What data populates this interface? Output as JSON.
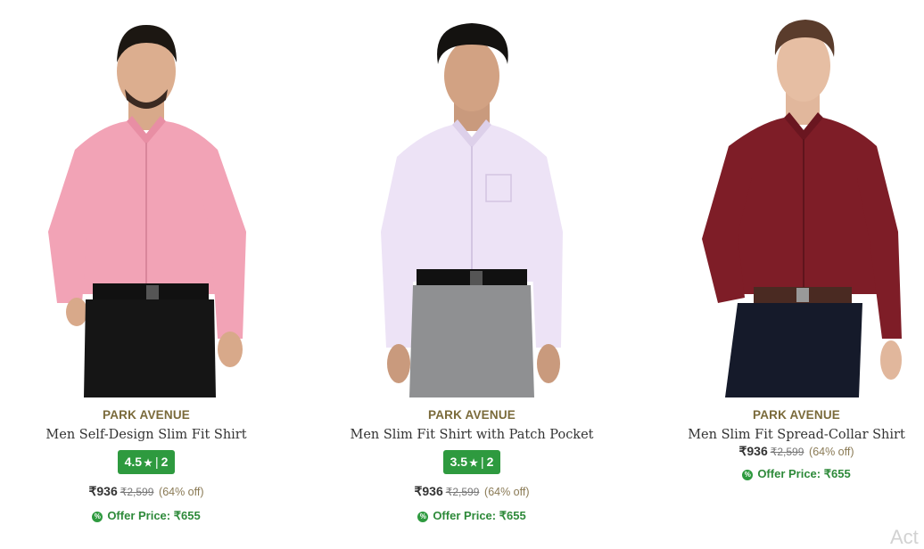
{
  "brand_color": "#7a6a3a",
  "rating_color": "#2e9a3f",
  "products": [
    {
      "brand": "PARK AVENUE",
      "title": "Men Self-Design Slim Fit Shirt",
      "rating": "4.5",
      "review_count": "2",
      "price": "₹936",
      "mrp": "₹2,599",
      "discount": "(64% off)",
      "offer_label": "Offer Price: ₹655",
      "offer_icon": "percent-icon",
      "shirt_color": "#f2a3b6",
      "pants_color": "#151515"
    },
    {
      "brand": "PARK AVENUE",
      "title": "Men Slim Fit Shirt with Patch Pocket",
      "rating": "3.5",
      "review_count": "2",
      "price": "₹936",
      "mrp": "₹2,599",
      "discount": "(64% off)",
      "offer_label": "Offer Price: ₹655",
      "offer_icon": "percent-icon",
      "shirt_color": "#ede3f6",
      "pants_color": "#8f9092"
    },
    {
      "brand": "PARK AVENUE",
      "title": "Men Slim Fit Spread-Collar Shirt",
      "price": "₹936",
      "mrp": "₹2,599",
      "discount": "(64% off)",
      "offer_label": "Offer Price: ₹655",
      "offer_icon": "percent-icon",
      "shirt_color": "#7e1d27",
      "pants_color": "#151a2a"
    }
  ],
  "watermark": "Act"
}
